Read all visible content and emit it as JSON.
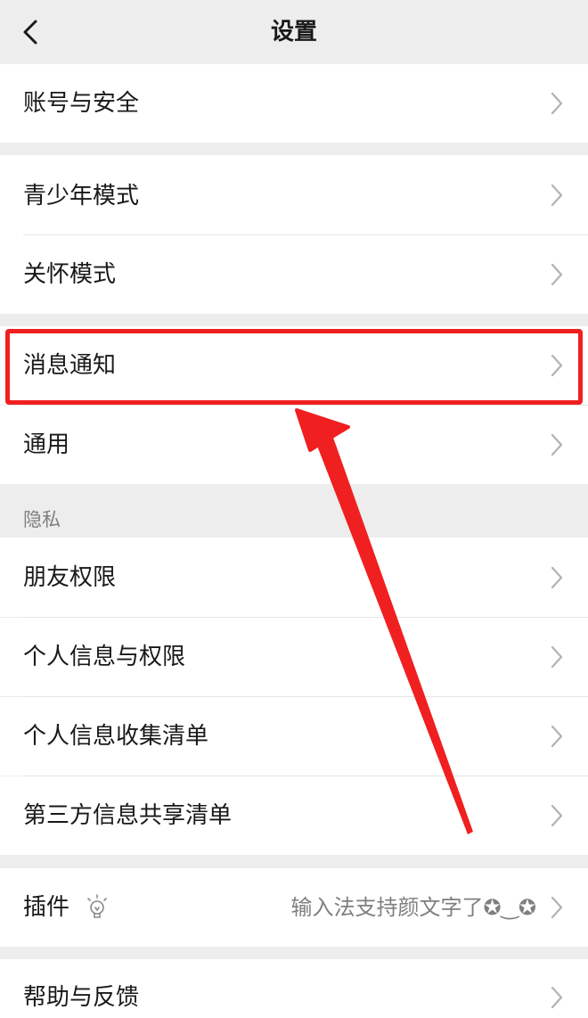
{
  "header": {
    "title": "设置"
  },
  "rows": {
    "account": {
      "label": "账号与安全"
    },
    "teen": {
      "label": "青少年模式"
    },
    "care": {
      "label": "关怀模式"
    },
    "notify": {
      "label": "消息通知"
    },
    "general": {
      "label": "通用"
    },
    "friends": {
      "label": "朋友权限"
    },
    "personal": {
      "label": "个人信息与权限"
    },
    "collect": {
      "label": "个人信息收集清单"
    },
    "thirdparty": {
      "label": "第三方信息共享清单"
    },
    "plugin": {
      "label": "插件",
      "hint": "输入法支持颜文字了✪‿✪"
    },
    "help": {
      "label": "帮助与反馈"
    }
  },
  "sections": {
    "privacy": "隐私"
  },
  "colors": {
    "annotation": "#f02020",
    "background": "#ededed",
    "row": "#ffffff"
  },
  "icons": {
    "back": "back-chevron-icon",
    "row": "chevron-right-icon",
    "plugin": "lightbulb-icon"
  }
}
